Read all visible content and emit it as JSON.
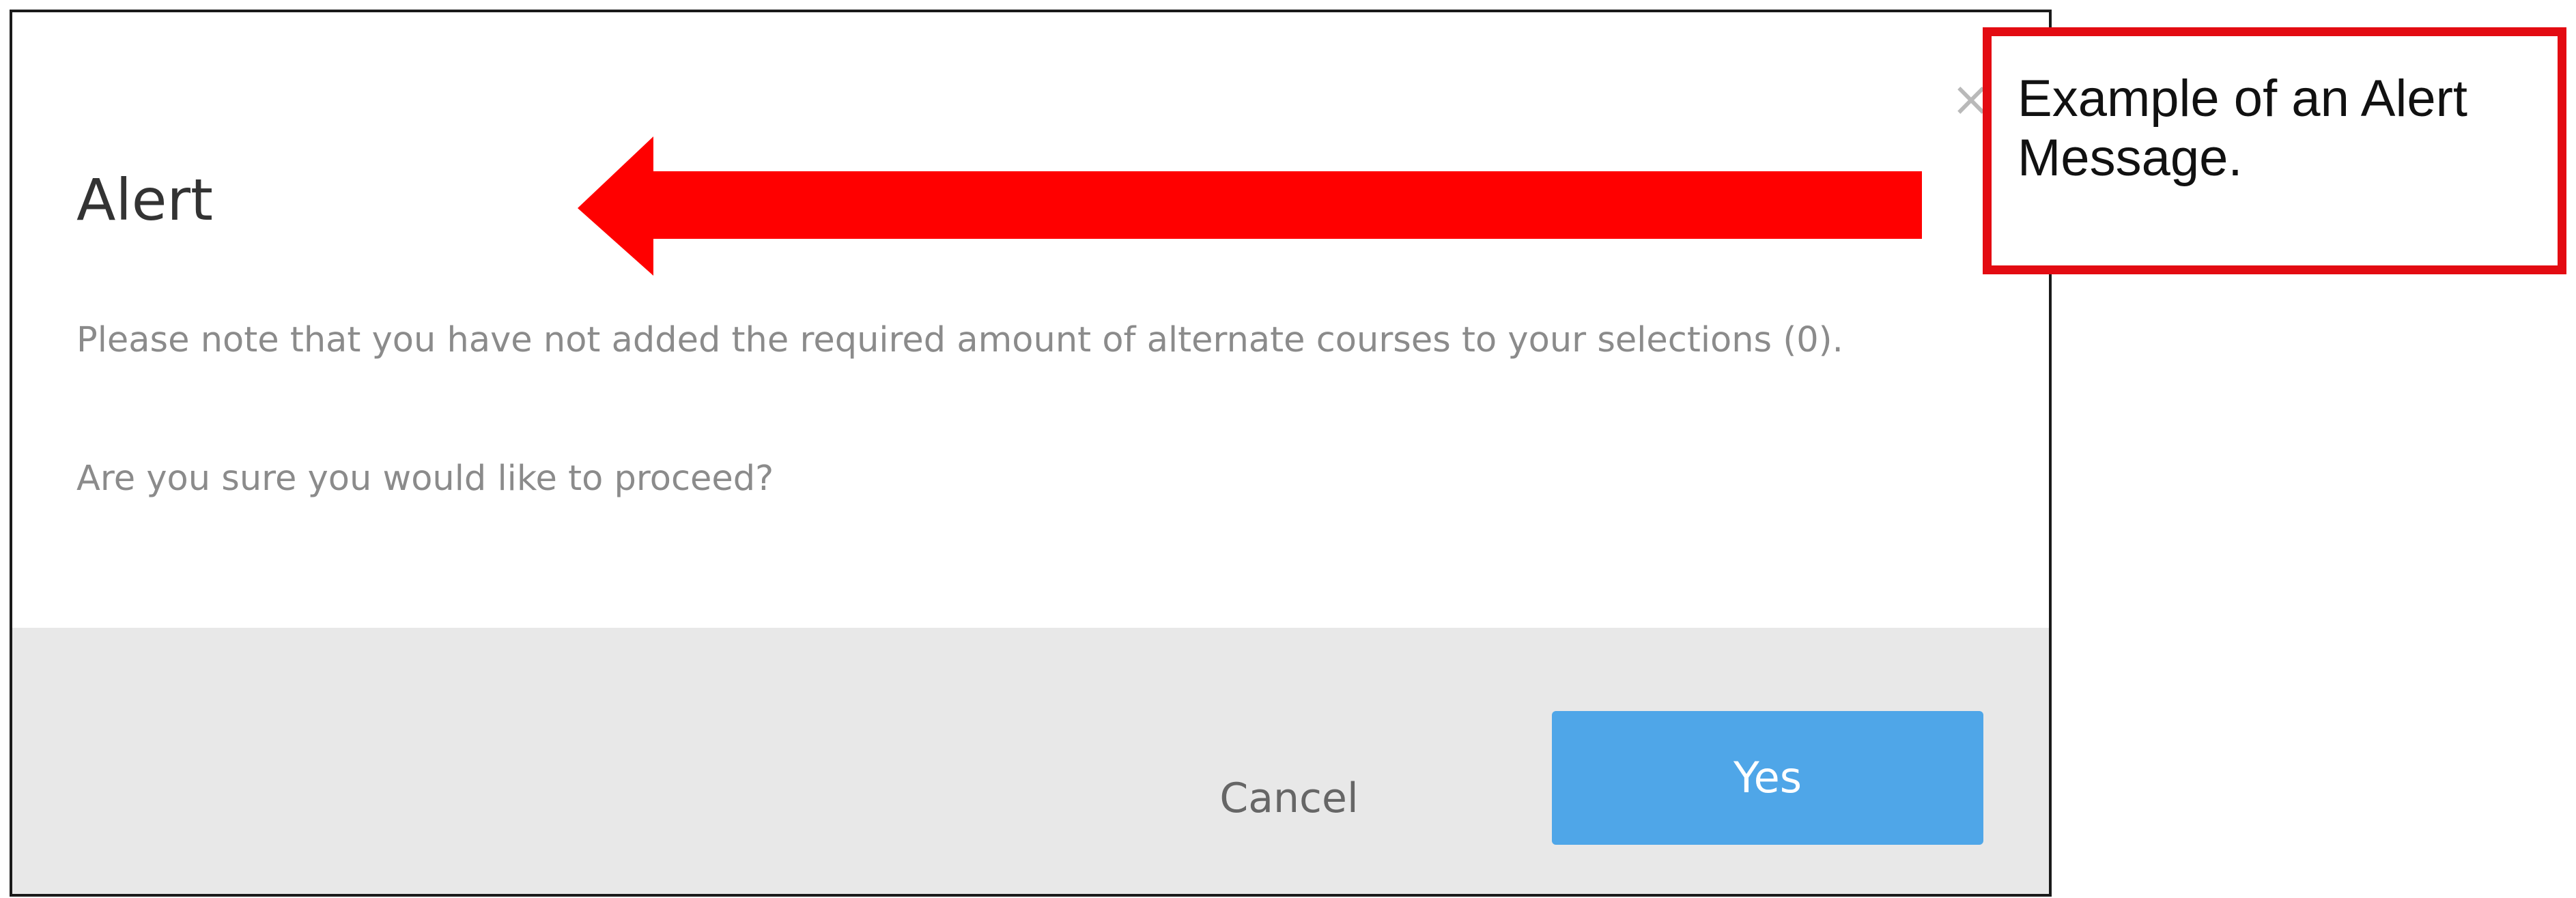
{
  "dialog": {
    "title": "Alert",
    "close_icon": "close-icon",
    "message": "Please note that you have not added the required amount of alternate courses to your selections (0).",
    "question": "Are you sure you would like to proceed?",
    "buttons": {
      "cancel": "Cancel",
      "yes": "Yes"
    }
  },
  "annotation": {
    "callout_line1": "Example of an Alert",
    "callout_line2": "Message.",
    "arrow_color": "#ff0000",
    "callout_border_color": "#e30b12"
  },
  "colors": {
    "primary_button": "#4fa6e8",
    "footer_background": "#e8e8e8",
    "body_text": "#8b8b8b"
  }
}
